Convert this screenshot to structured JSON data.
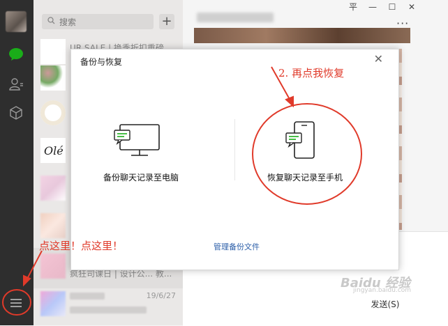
{
  "sidebar": {
    "icons": [
      "chat-bubble-icon",
      "contacts-icon",
      "box-icon",
      "menu-icon"
    ]
  },
  "chatlist": {
    "search_placeholder": "搜索",
    "add_label": "+",
    "items": [
      {
        "line": "UR SALE | 换季折扣重磅...",
        "time": ""
      },
      {
        "line": "",
        "time": ""
      },
      {
        "line": "",
        "time": ""
      },
      {
        "line": "",
        "time": ""
      },
      {
        "line": "",
        "time": ""
      },
      {
        "line": "",
        "time": ""
      },
      {
        "line": "疯狂司课日 | 设计公... 教...",
        "time": ""
      },
      {
        "line": "",
        "time": "19/6/27"
      }
    ]
  },
  "window": {
    "pin_label": "平",
    "minimize_label": "—",
    "maximize_label": "☐",
    "close_label": "✕",
    "more_label": "···"
  },
  "main": {
    "send_label": "发送(S)"
  },
  "modal": {
    "title": "备份与恢复",
    "close_label": "✕",
    "backup_label": "备份聊天记录至电脑",
    "restore_label": "恢复聊天记录至手机",
    "manage_label": "管理备份文件"
  },
  "annotations": {
    "step2": "2. 再点我恢复",
    "click_here": "点这里！点这里！"
  },
  "watermark": {
    "brand": "Baidu 经验",
    "sub": "jingyan.baidu.com"
  },
  "colors": {
    "sidebar_bg": "#2e2e2e",
    "chatlist_bg": "#eae8e7",
    "annotation_red": "#e03a2a",
    "wechat_green": "#1aad19",
    "link_blue": "#2b5ea8"
  }
}
